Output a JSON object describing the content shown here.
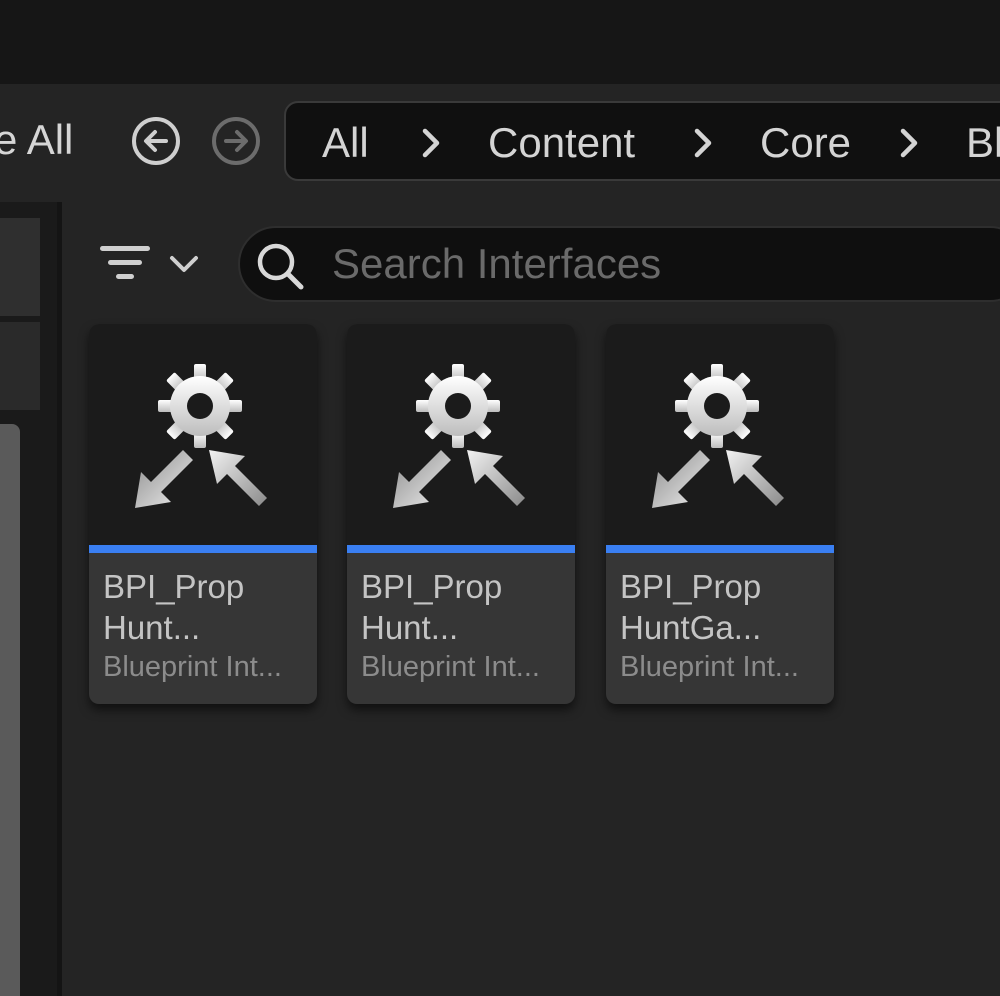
{
  "toolbar": {
    "save_all_label": "e All"
  },
  "navigation": {
    "back_icon": "arrow-left-circle",
    "forward_icon": "arrow-right-circle"
  },
  "breadcrumb": {
    "items": [
      "All",
      "Content",
      "Core",
      "Bl"
    ],
    "separator_icon": "chevron-right"
  },
  "filter": {
    "icon": "filter-lines",
    "dropdown_icon": "chevron-down"
  },
  "search": {
    "placeholder": "Search Interfaces",
    "value": ""
  },
  "assets": [
    {
      "name_line1": "BPI_Prop",
      "name_line2": "Hunt...",
      "type": "Blueprint Int..."
    },
    {
      "name_line1": "BPI_Prop",
      "name_line2": "Hunt...",
      "type": "Blueprint Int..."
    },
    {
      "name_line1": "BPI_Prop",
      "name_line2": "HuntGa...",
      "type": "Blueprint Int..."
    }
  ],
  "colors": {
    "asset_type_bar": "#3a7ff2",
    "background": "#242424"
  }
}
